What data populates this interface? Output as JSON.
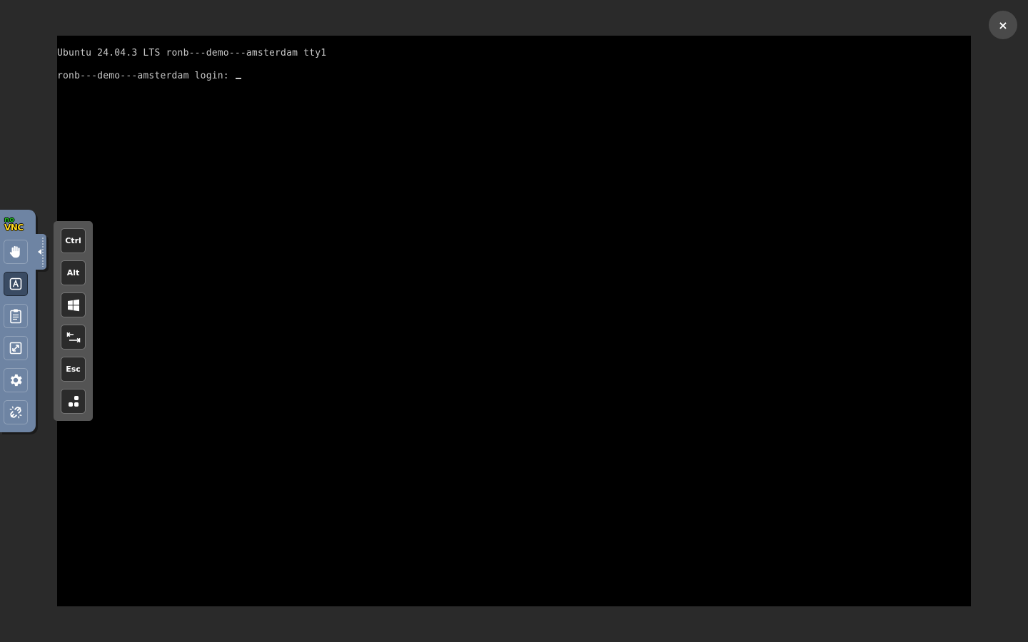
{
  "terminal": {
    "line1": "Ubuntu 24.04.3 LTS ronb---demo---amsterdam tty1",
    "line2": "ronb---demo---amsterdam login: "
  },
  "close_button": {
    "label": "×",
    "icon": "close-icon"
  },
  "control_bar": {
    "logo": {
      "top": "no",
      "bottom": "VNC"
    },
    "buttons": [
      {
        "icon": "hand-drag-icon",
        "selected": false
      },
      {
        "icon": "keyboard-icon",
        "selected": true
      },
      {
        "icon": "clipboard-icon",
        "selected": false
      },
      {
        "icon": "fullscreen-icon",
        "selected": false
      },
      {
        "icon": "gear-icon",
        "selected": false
      },
      {
        "icon": "disconnect-icon",
        "selected": false
      }
    ],
    "handle_icon": "collapse-arrow-icon"
  },
  "extra_keys": [
    {
      "label": "Ctrl",
      "icon": ""
    },
    {
      "label": "Alt",
      "icon": ""
    },
    {
      "label": "",
      "icon": "windows-key-icon"
    },
    {
      "label": "",
      "icon": "tab-key-icon"
    },
    {
      "label": "Esc",
      "icon": ""
    },
    {
      "label": "",
      "icon": "ctrl-alt-del-icon"
    }
  ],
  "colors": {
    "background": "#2a2a2a",
    "control_bar": "#6e84a3",
    "selected_button": "#3a4b63",
    "terminal_text": "#c8c8c8",
    "logo_no": "#23c023",
    "logo_vnc": "#ffd71e"
  }
}
